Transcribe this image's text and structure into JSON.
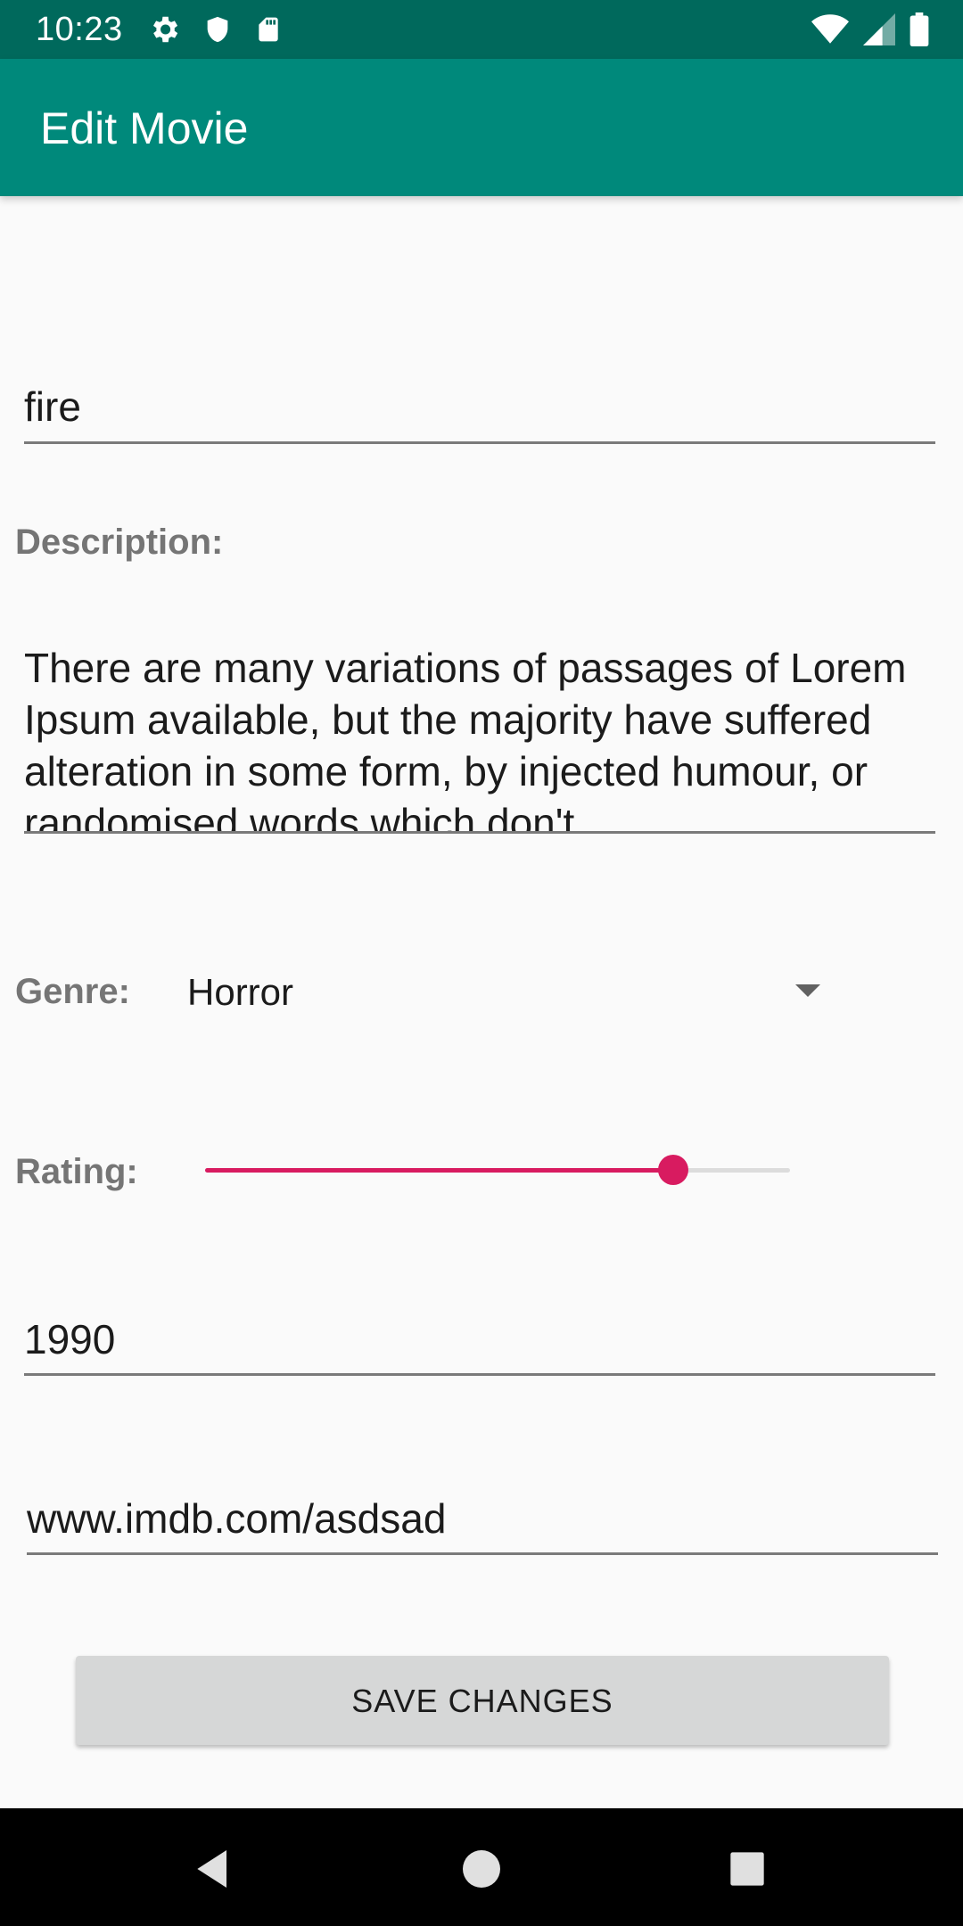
{
  "status_bar": {
    "time": "10:23",
    "left_icons": [
      "settings-icon",
      "shield-icon",
      "sd-card-icon"
    ],
    "right_icons": [
      "wifi-icon",
      "signal-icon",
      "battery-icon"
    ]
  },
  "app_bar": {
    "title": "Edit Movie",
    "background_color": "#00897b",
    "status_color": "#00695c"
  },
  "form": {
    "title_value": "fire",
    "description_label": "Description:",
    "description_value": "There are many variations of passages of Lorem Ipsum available, but the majority have suffered alteration in some form, by injected humour, or randomised words which don't",
    "genre_label": "Genre:",
    "genre_value": "Horror",
    "rating_label": "Rating:",
    "rating_fraction": 0.8,
    "accent_color": "#d81b60",
    "year_value": "1990",
    "url_value": "www.imdb.com/asdsad"
  },
  "actions": {
    "save_label": "SAVE CHANGES"
  },
  "nav_bar": {
    "icons": [
      "back-icon",
      "home-icon",
      "recents-icon"
    ]
  }
}
